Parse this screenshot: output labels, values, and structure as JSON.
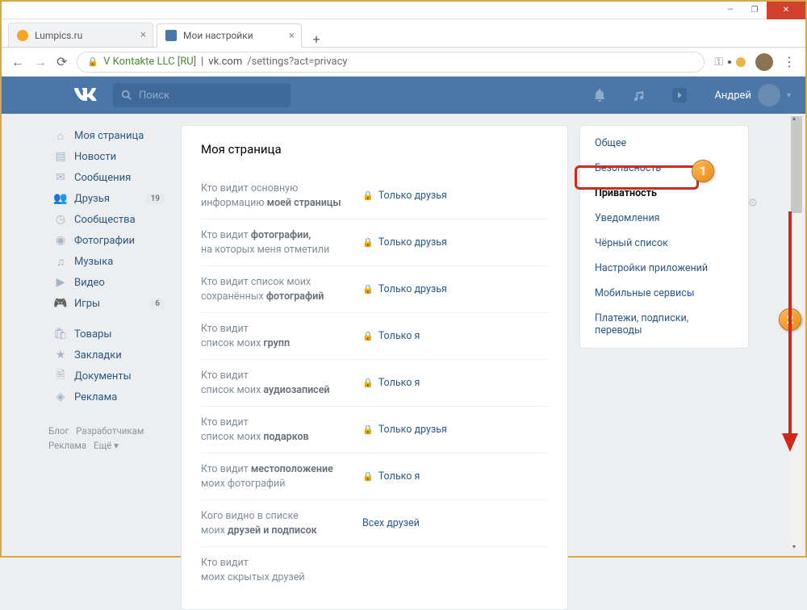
{
  "window": {
    "minimize": "—",
    "maximize": "❐",
    "close": "✕"
  },
  "tabs": {
    "inactive": {
      "title": "Lumpics.ru"
    },
    "active": {
      "title": "Мои настройки"
    },
    "new": "+"
  },
  "addressbar": {
    "org": "V Kontakte LLC [RU]",
    "sep": " | ",
    "host": "vk.com",
    "path": "/settings?act=privacy"
  },
  "vk": {
    "search_placeholder": "Поиск",
    "username": "Андрей"
  },
  "sidebar": {
    "items": [
      {
        "icon": "home",
        "label": "Моя страница"
      },
      {
        "icon": "news",
        "label": "Новости"
      },
      {
        "icon": "msg",
        "label": "Сообщения"
      },
      {
        "icon": "friends",
        "label": "Друзья",
        "badge": "19"
      },
      {
        "icon": "groups",
        "label": "Сообщества"
      },
      {
        "icon": "photos",
        "label": "Фотографии"
      },
      {
        "icon": "music",
        "label": "Музыка"
      },
      {
        "icon": "video",
        "label": "Видео"
      },
      {
        "icon": "games",
        "label": "Игры",
        "badge": "6"
      }
    ],
    "items2": [
      {
        "icon": "market",
        "label": "Товары"
      },
      {
        "icon": "bookmarks",
        "label": "Закладки"
      },
      {
        "icon": "docs",
        "label": "Документы"
      },
      {
        "icon": "ads",
        "label": "Реклама"
      }
    ],
    "footer": {
      "blog": "Блог",
      "devs": "Разработчикам",
      "ads": "Реклама",
      "more": "Ещё ▾"
    }
  },
  "main": {
    "title": "Моя страница",
    "rows": [
      {
        "l1": "Кто видит основную",
        "l2_pre": "информацию ",
        "l2_bold": "моей страницы",
        "value": "Только друзья",
        "lock": true
      },
      {
        "l1_pre": "Кто видит ",
        "l1_bold": "фотографии,",
        "l2": "на которых меня отметили",
        "value": "Только друзья",
        "lock": true
      },
      {
        "l1": "Кто видит список моих",
        "l2_pre": "сохранённых ",
        "l2_bold": "фотографий",
        "value": "Только друзья",
        "lock": true
      },
      {
        "l1": "Кто видит",
        "l2_pre": "список моих ",
        "l2_bold": "групп",
        "value": "Только я",
        "lock": true
      },
      {
        "l1": "Кто видит",
        "l2_pre": "список моих ",
        "l2_bold": "аудиозаписей",
        "value": "Только я",
        "lock": true
      },
      {
        "l1": "Кто видит",
        "l2_pre": "список моих ",
        "l2_bold": "подарков",
        "value": "Только друзья",
        "lock": true
      },
      {
        "l1_pre": "Кто видит ",
        "l1_bold": "местоположение",
        "l2": "моих фотографий",
        "value": "Только я",
        "lock": true
      },
      {
        "l1": "Кого видно в списке",
        "l2_pre": "моих ",
        "l2_bold": "друзей и подписок",
        "value": "Всех друзей",
        "lock": false
      },
      {
        "l1": "Кто видит",
        "l2": "моих скрытых друзей",
        "value": "",
        "lock": false
      }
    ]
  },
  "right": {
    "items": [
      "Общее",
      "Безопасность",
      "Приватность",
      "Уведомления",
      "Чёрный список",
      "Настройки приложений",
      "Мобильные сервисы",
      "Платежи, подписки, переводы"
    ]
  },
  "markers": {
    "m1": "1",
    "m2": "2"
  }
}
